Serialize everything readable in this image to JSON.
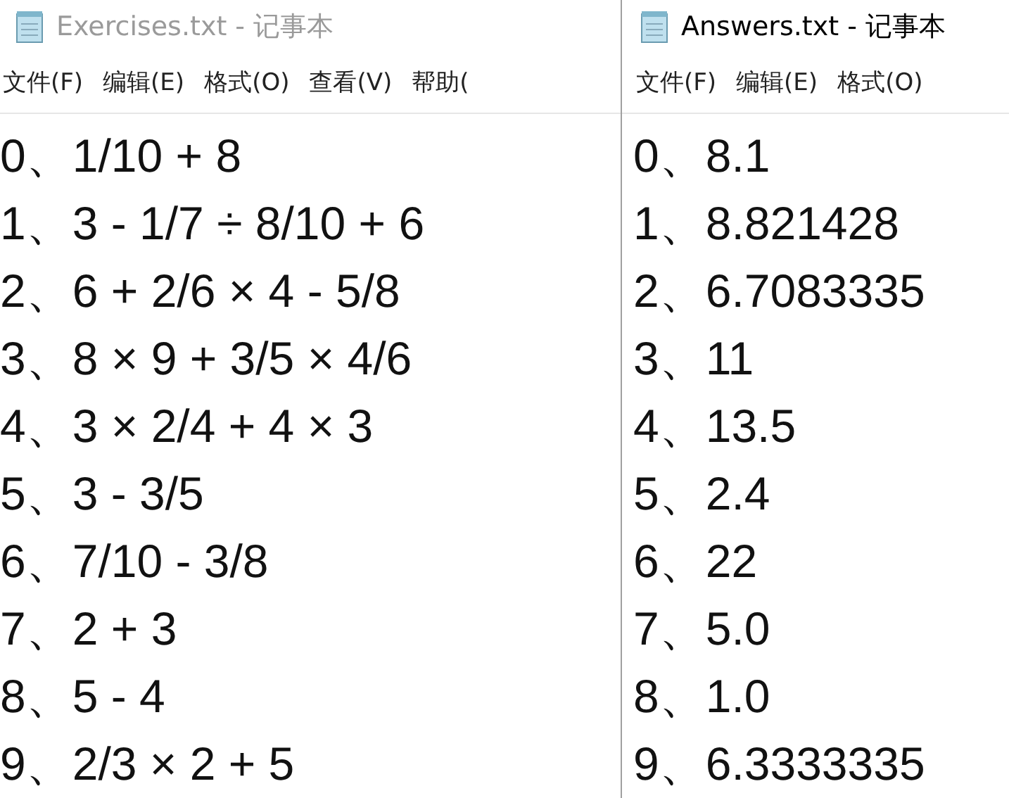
{
  "windows": [
    {
      "title": "Exercises.txt - 记事本",
      "active": false,
      "menu": [
        "文件(F)",
        "编辑(E)",
        "格式(O)",
        "查看(V)",
        "帮助("
      ],
      "lines": [
        "0、1/10 + 8",
        "1、3 - 1/7 ÷ 8/10 + 6",
        "2、6 + 2/6 × 4 - 5/8",
        "3、8 × 9 + 3/5 × 4/6",
        "4、3 × 2/4 + 4 × 3",
        "5、3 - 3/5",
        "6、7/10 - 3/8",
        "7、2 + 3",
        "8、5 - 4",
        "9、2/3 × 2 + 5"
      ]
    },
    {
      "title": "Answers.txt - 记事本",
      "active": true,
      "menu": [
        "文件(F)",
        "编辑(E)",
        "格式(O)"
      ],
      "lines": [
        "0、8.1",
        "1、8.821428",
        "2、6.7083335",
        "3、11",
        "4、13.5",
        "5、2.4",
        "6、22",
        "7、5.0",
        "8、1.0",
        "9、6.3333335"
      ]
    }
  ]
}
